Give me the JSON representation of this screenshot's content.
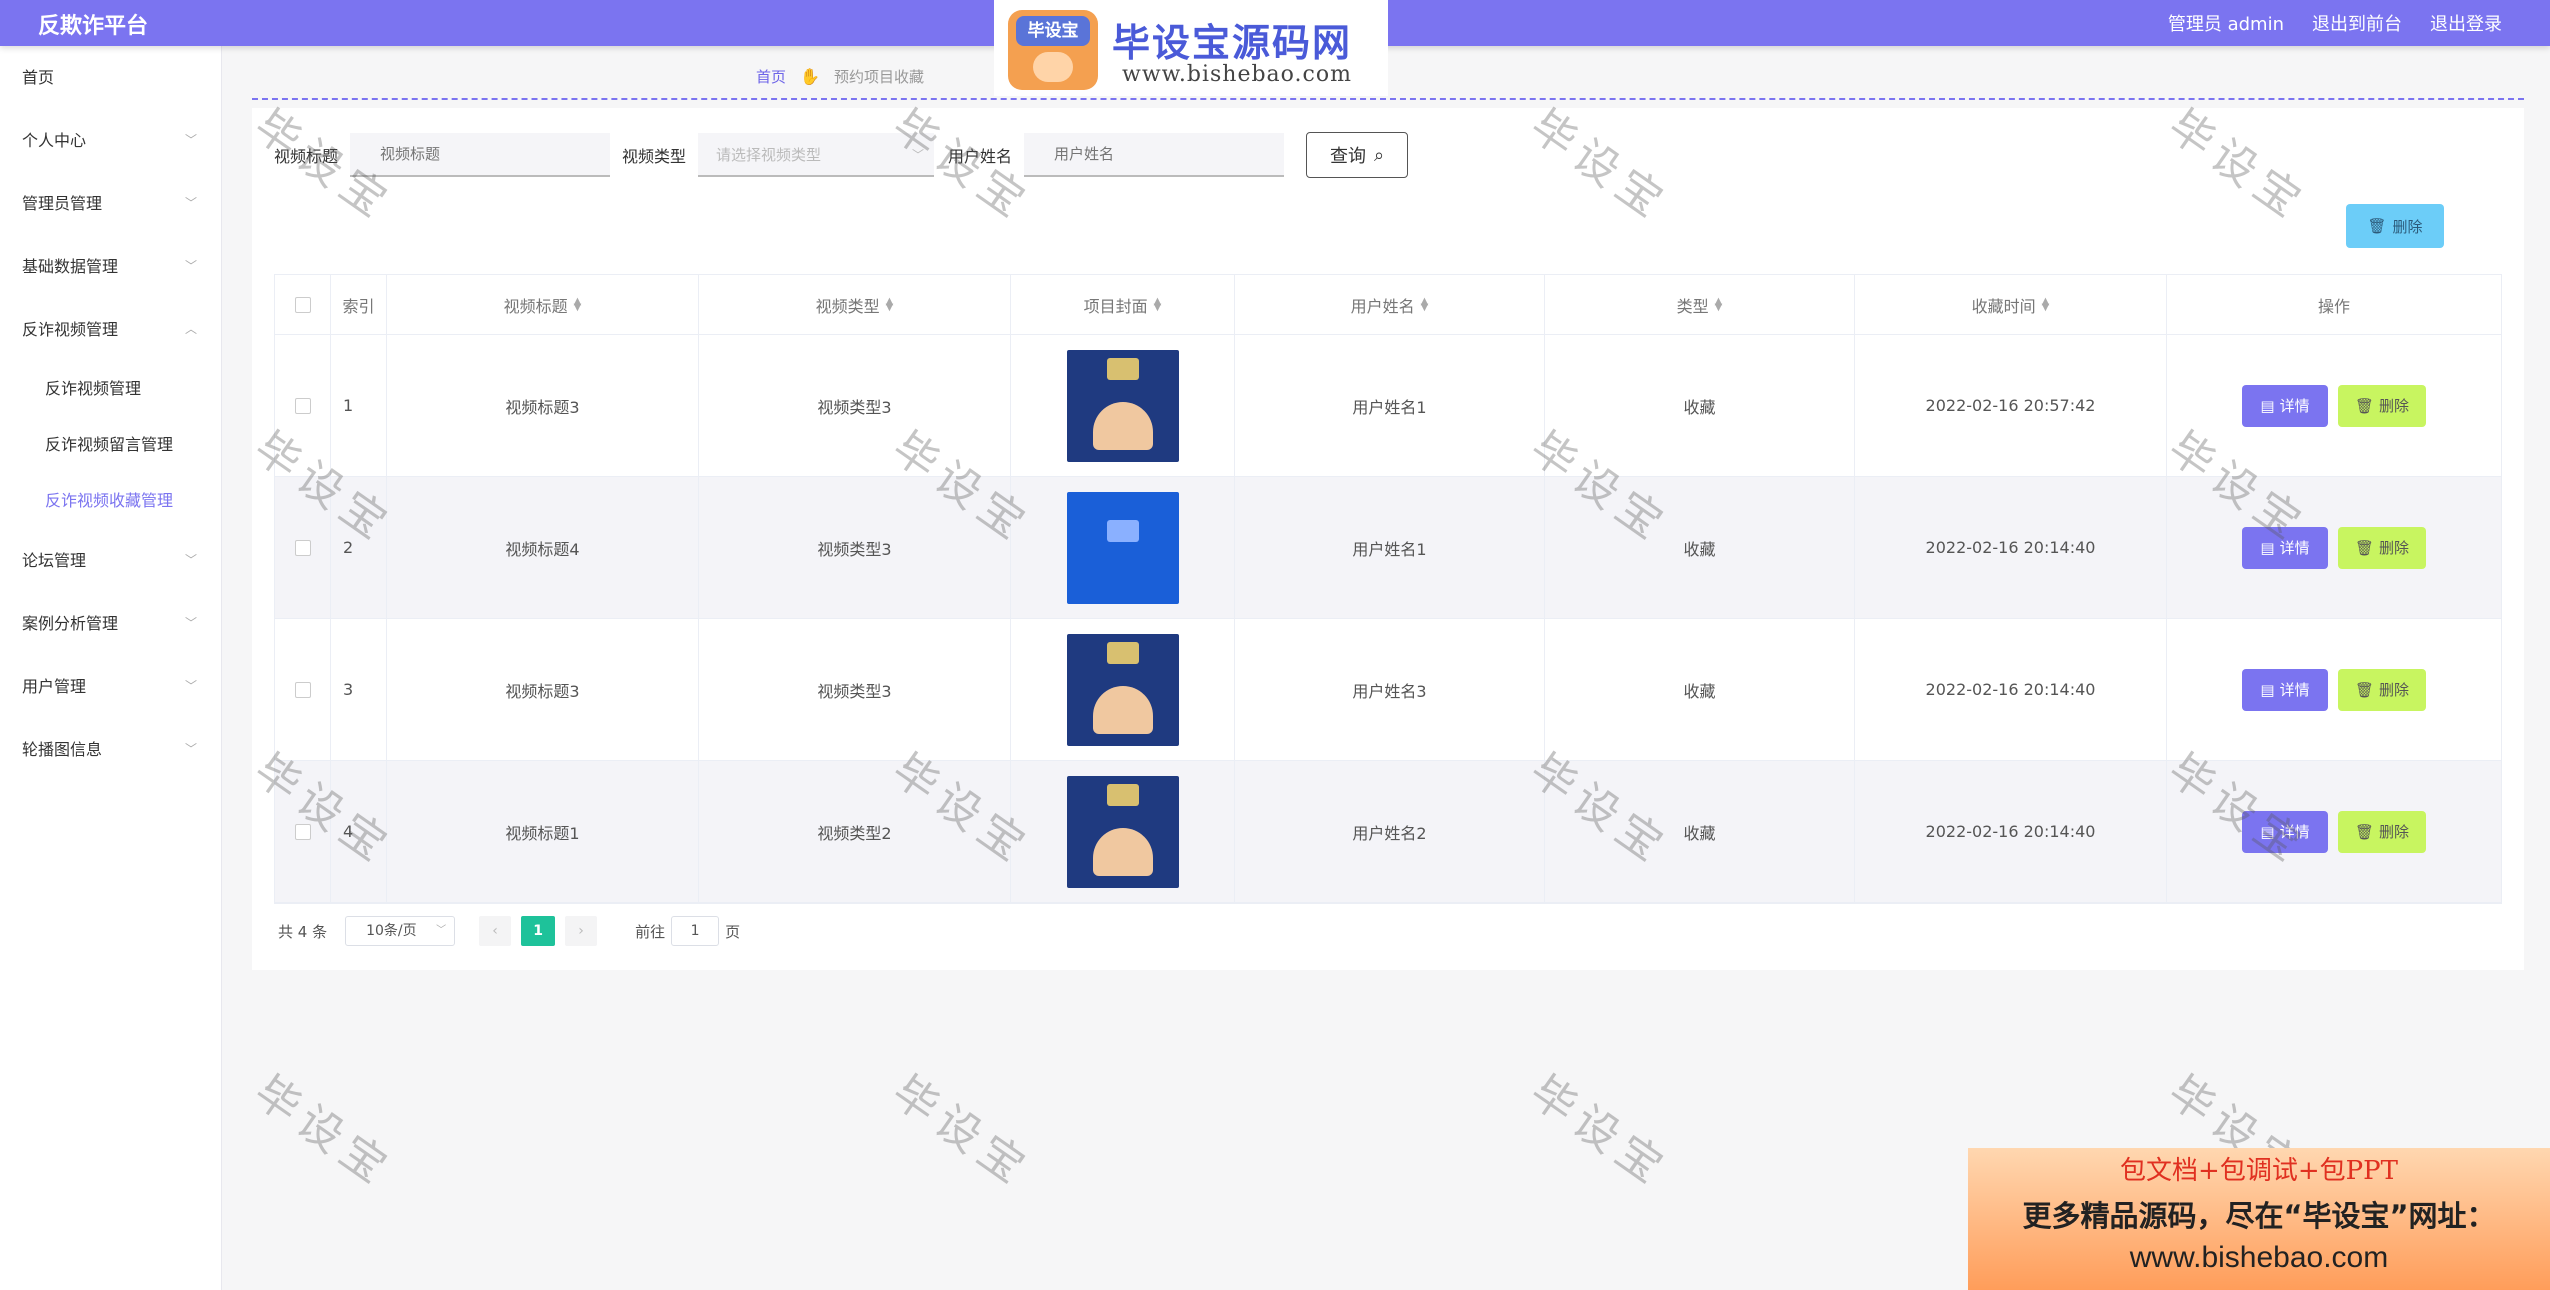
{
  "header": {
    "brand": "反欺诈平台",
    "user": "管理员 admin",
    "back_front": "退出到前台",
    "logout": "退出登录"
  },
  "sidebar": {
    "items": [
      {
        "label": "首页"
      },
      {
        "label": "个人中心"
      },
      {
        "label": "管理员管理"
      },
      {
        "label": "基础数据管理"
      },
      {
        "label": "反诈视频管理"
      },
      {
        "label": "论坛管理"
      },
      {
        "label": "案例分析管理"
      },
      {
        "label": "用户管理"
      },
      {
        "label": "轮播图信息"
      }
    ],
    "sub_items": [
      {
        "label": "反诈视频管理"
      },
      {
        "label": "反诈视频留言管理"
      },
      {
        "label": "反诈视频收藏管理"
      }
    ]
  },
  "breadcrumb": {
    "home": "首页",
    "current": "预约项目收藏"
  },
  "search": {
    "title_label": "视频标题",
    "title_placeholder": "视频标题",
    "type_label": "视频类型",
    "type_placeholder": "请选择视频类型",
    "user_label": "用户姓名",
    "user_placeholder": "用户姓名",
    "query_label": "查询"
  },
  "toolbar": {
    "delete_label": "删除"
  },
  "table": {
    "columns": [
      "索引",
      "视频标题",
      "视频类型",
      "项目封面",
      "用户姓名",
      "类型",
      "收藏时间",
      "操作"
    ],
    "rows": [
      {
        "index": "1",
        "title": "视频标题3",
        "type": "视频类型3",
        "user": "用户姓名1",
        "kind": "收藏",
        "time": "2022-02-16 20:57:42"
      },
      {
        "index": "2",
        "title": "视频标题4",
        "type": "视频类型3",
        "user": "用户姓名1",
        "kind": "收藏",
        "time": "2022-02-16 20:14:40"
      },
      {
        "index": "3",
        "title": "视频标题3",
        "type": "视频类型3",
        "user": "用户姓名3",
        "kind": "收藏",
        "time": "2022-02-16 20:14:40"
      },
      {
        "index": "4",
        "title": "视频标题1",
        "type": "视频类型2",
        "user": "用户姓名2",
        "kind": "收藏",
        "time": "2022-02-16 20:14:40"
      }
    ],
    "detail_label": "详情",
    "delete_label": "删除"
  },
  "pagination": {
    "total": "共 4 条",
    "page_size": "10条/页",
    "current_page": "1",
    "goto_prefix": "前往",
    "goto_value": "1",
    "goto_suffix": "页"
  },
  "watermark": {
    "text": "毕设宝"
  },
  "logo": {
    "mark": "毕设宝",
    "title": "毕设宝源码网",
    "url": "www.bishebao.com"
  },
  "ad": {
    "line1": "包文档+包调试+包PPT",
    "line2": "更多精品源码，尽在“毕设宝”网址：",
    "line3": "www.bishebao.com"
  },
  "colors": {
    "topbar": "#7b74f0",
    "accent": "#7b74f0",
    "detail_button": "#7b74f0",
    "delete_button": "#c8f560",
    "batch_delete": "#6ccdf8",
    "pager_active": "#1ec29a"
  }
}
